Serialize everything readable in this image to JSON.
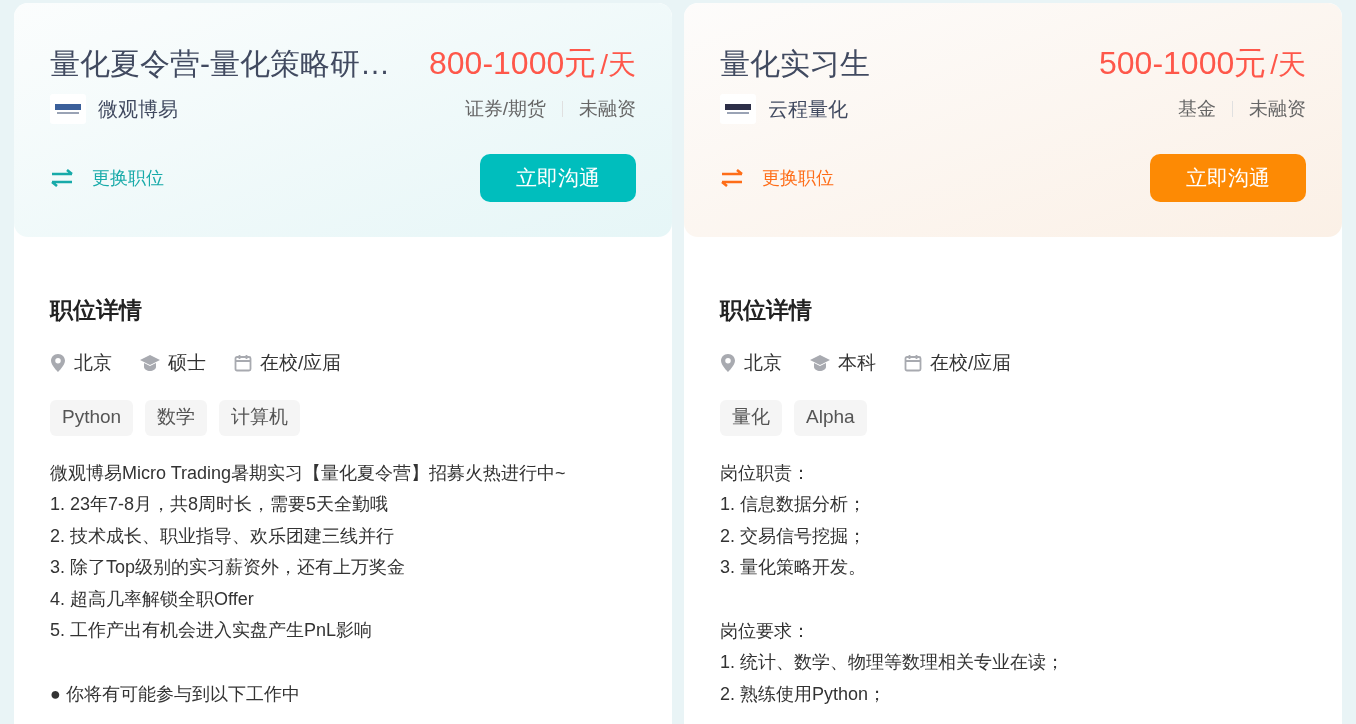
{
  "jobs": [
    {
      "kind": "teal",
      "title": "量化夏令营-量化策略研…",
      "salary": "800-1000元",
      "salary_unit": "/天",
      "company": "微观博易",
      "company_tags": [
        "证券/期货",
        "未融资"
      ],
      "switch_label": "更换职位",
      "chat_button": "立即沟通",
      "section_title": "职位详情",
      "meta": [
        {
          "kind": "location",
          "text": "北京"
        },
        {
          "kind": "degree",
          "text": "硕士"
        },
        {
          "kind": "calendar",
          "text": "在校/应届"
        }
      ],
      "skills": [
        "Python",
        "数学",
        "计算机"
      ],
      "paragraphs": [
        [
          "微观博易Micro Trading暑期实习【量化夏令营】招募火热进行中~",
          "1. 23年7-8月，共8周时长，需要5天全勤哦",
          "2. 技术成长、职业指导、欢乐团建三线并行",
          "3. 除了Top级别的实习薪资外，还有上万奖金",
          "4. 超高几率解锁全职Offer",
          "5. 工作产出有机会进入实盘产生PnL影响"
        ],
        [
          "● 你将有可能参与到以下工作中"
        ]
      ]
    },
    {
      "kind": "orange",
      "title": "量化实习生",
      "salary": "500-1000元",
      "salary_unit": "/天",
      "company": "云程量化",
      "company_tags": [
        "基金",
        "未融资"
      ],
      "switch_label": "更换职位",
      "chat_button": "立即沟通",
      "section_title": "职位详情",
      "meta": [
        {
          "kind": "location",
          "text": "北京"
        },
        {
          "kind": "degree",
          "text": "本科"
        },
        {
          "kind": "calendar",
          "text": "在校/应届"
        }
      ],
      "skills": [
        "量化",
        "Alpha"
      ],
      "paragraphs": [
        [
          "岗位职责：",
          "1. 信息数据分析；",
          "2. 交易信号挖掘；",
          "3. 量化策略开发。"
        ],
        [
          "岗位要求：",
          "1. 统计、数学、物理等数理相关专业在读；",
          "2. 熟练使用Python；"
        ]
      ]
    }
  ]
}
